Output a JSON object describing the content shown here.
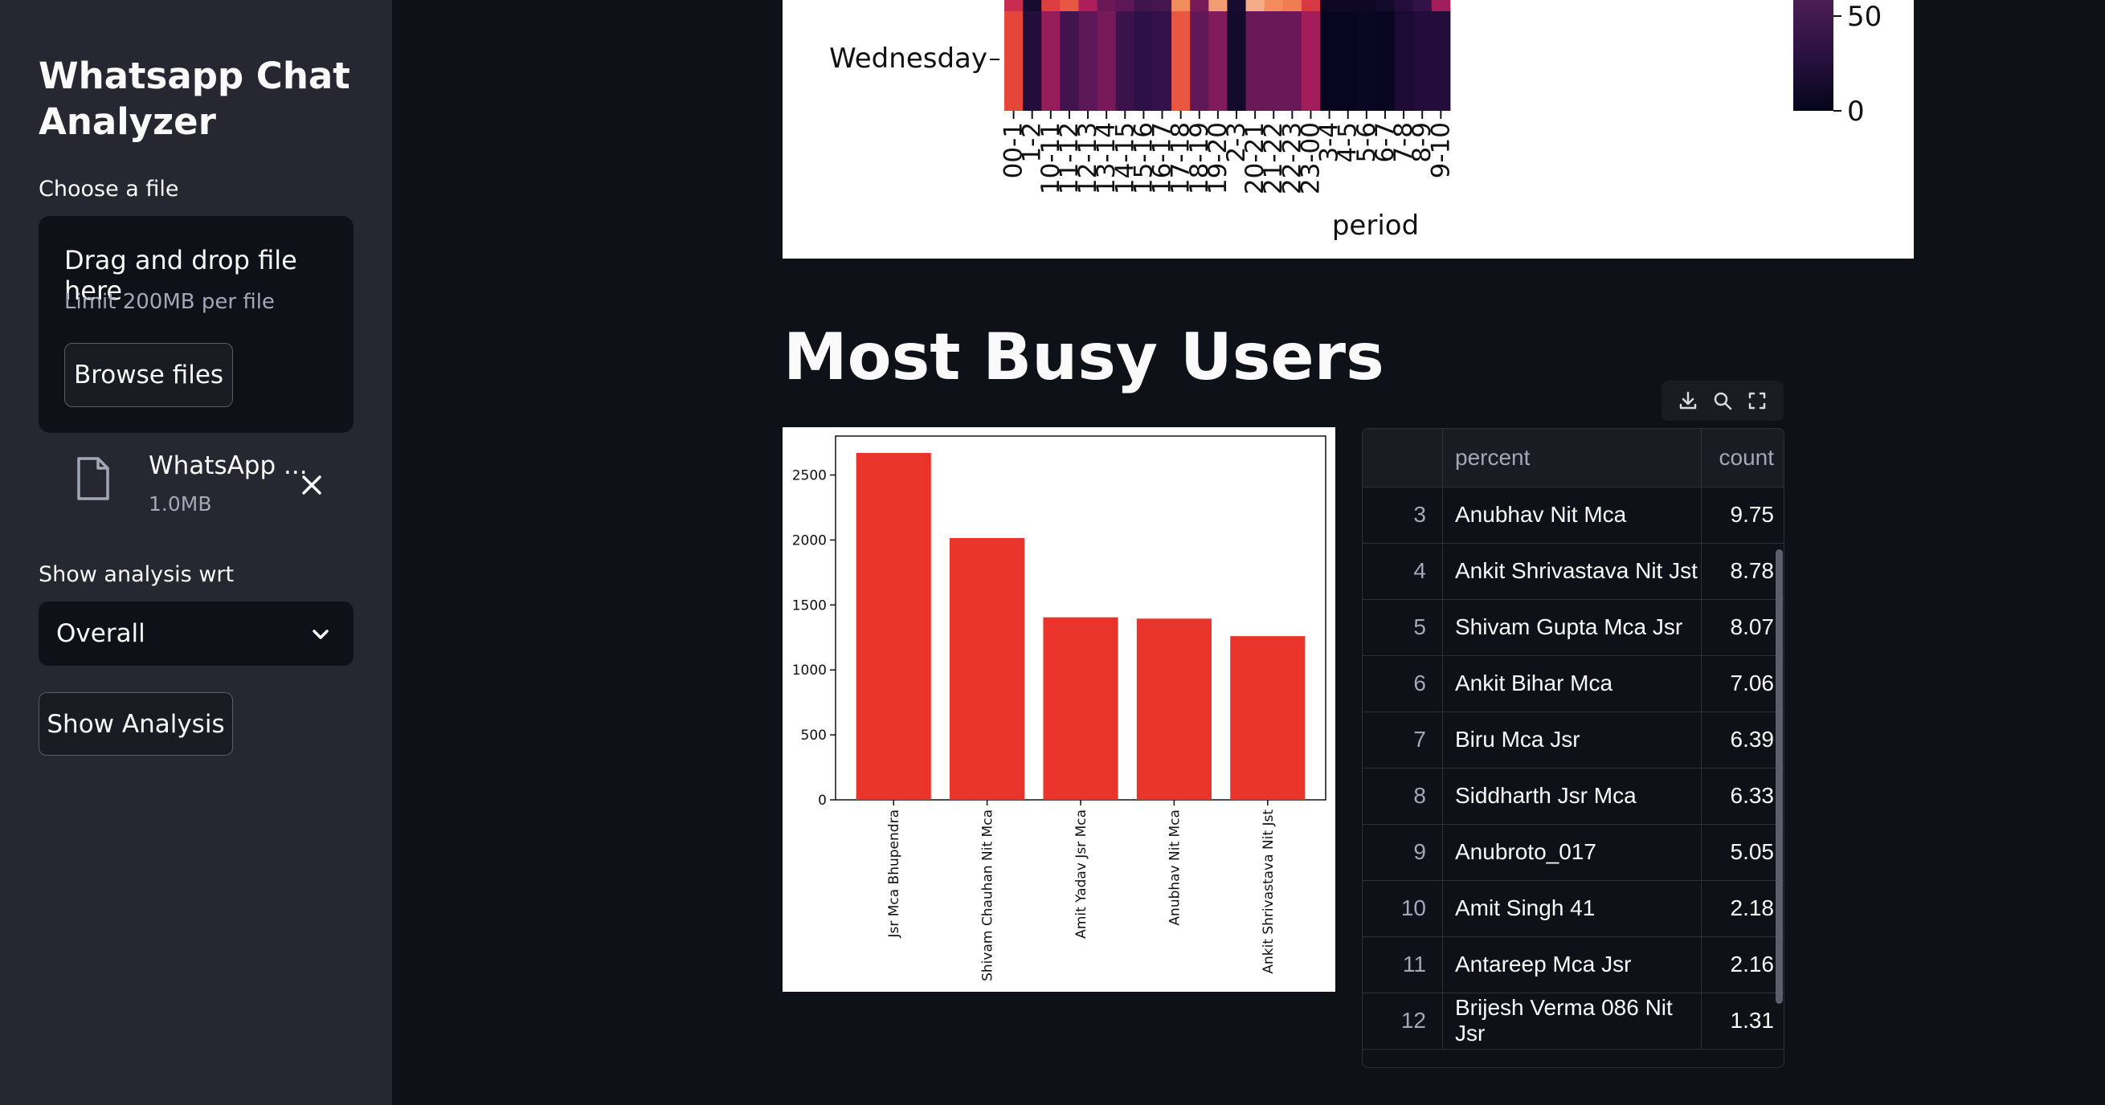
{
  "sidebar": {
    "app_title": "Whatsapp Chat Analyzer",
    "file_label": "Choose a file",
    "dropzone_title": "Drag and drop file here",
    "dropzone_limit": "Limit 200MB per file",
    "browse_label": "Browse files",
    "file_name": "WhatsApp ...",
    "file_size": "1.0MB",
    "analysis_label": "Show analysis wrt",
    "selected_user": "Overall",
    "show_button": "Show Analysis"
  },
  "heatmap": {
    "ylabel_visible": "Wednesday",
    "xlabel": "period",
    "periods": [
      "00-1",
      "1-2",
      "10-11",
      "11-12",
      "12-13",
      "13-14",
      "14-15",
      "15-16",
      "16-17",
      "17-18",
      "18-19",
      "19-20",
      "2-3",
      "20-21",
      "21-22",
      "22-23",
      "23-00",
      "3-4",
      "4-5",
      "5-6",
      "6-7",
      "7-8",
      "8-9",
      "9-10"
    ],
    "wednesday_values": [
      75,
      15,
      52,
      28,
      38,
      45,
      25,
      20,
      22,
      78,
      40,
      48,
      8,
      42,
      42,
      42,
      55,
      2,
      2,
      3,
      2,
      12,
      15,
      15
    ],
    "top_row_values": [
      65,
      10,
      72,
      78,
      58,
      42,
      38,
      28,
      30,
      88,
      45,
      90,
      10,
      92,
      88,
      85,
      70,
      5,
      5,
      5,
      8,
      15,
      22,
      55
    ],
    "colorbar_ticks": [
      "50",
      "0"
    ],
    "colors": {
      "low": "#03051a",
      "high": "#faebdd"
    }
  },
  "section_title": "Most Busy Users",
  "chart_data": {
    "type": "bar",
    "categories": [
      "Jsr Mca Bhupendra",
      "Shivam Chauhan Nit Mca",
      "Amit Yadav Jsr Mca",
      "Anubhav Nit Mca",
      "Ankit Shrivastava Nit Jst"
    ],
    "values": [
      2670,
      2015,
      1405,
      1395,
      1260
    ],
    "ylim": [
      0,
      2800
    ],
    "yticks": [
      0,
      500,
      1000,
      1500,
      2000,
      2500
    ],
    "bar_color": "#e8342a",
    "xlabel": "",
    "ylabel": "",
    "title": ""
  },
  "toolbar": {
    "icons": [
      "download-icon",
      "search-icon",
      "fullscreen-icon"
    ]
  },
  "table": {
    "headers": {
      "index": "",
      "name": "percent",
      "value": "count"
    },
    "rows": [
      {
        "index": "3",
        "name": "Anubhav Nit Mca",
        "value": "9.75"
      },
      {
        "index": "4",
        "name": "Ankit Shrivastava Nit Jst",
        "value": "8.78"
      },
      {
        "index": "5",
        "name": "Shivam Gupta Mca Jsr",
        "value": "8.07"
      },
      {
        "index": "6",
        "name": "Ankit Bihar Mca",
        "value": "7.06"
      },
      {
        "index": "7",
        "name": "Biru Mca Jsr",
        "value": "6.39"
      },
      {
        "index": "8",
        "name": "Siddharth Jsr Mca",
        "value": "6.33"
      },
      {
        "index": "9",
        "name": "Anubroto_017",
        "value": "5.05"
      },
      {
        "index": "10",
        "name": "Amit Singh 41",
        "value": "2.18"
      },
      {
        "index": "11",
        "name": "Antareep Mca Jsr",
        "value": "2.16"
      },
      {
        "index": "12",
        "name": "Brijesh Verma 086 Nit Jsr",
        "value": "1.31"
      }
    ]
  }
}
